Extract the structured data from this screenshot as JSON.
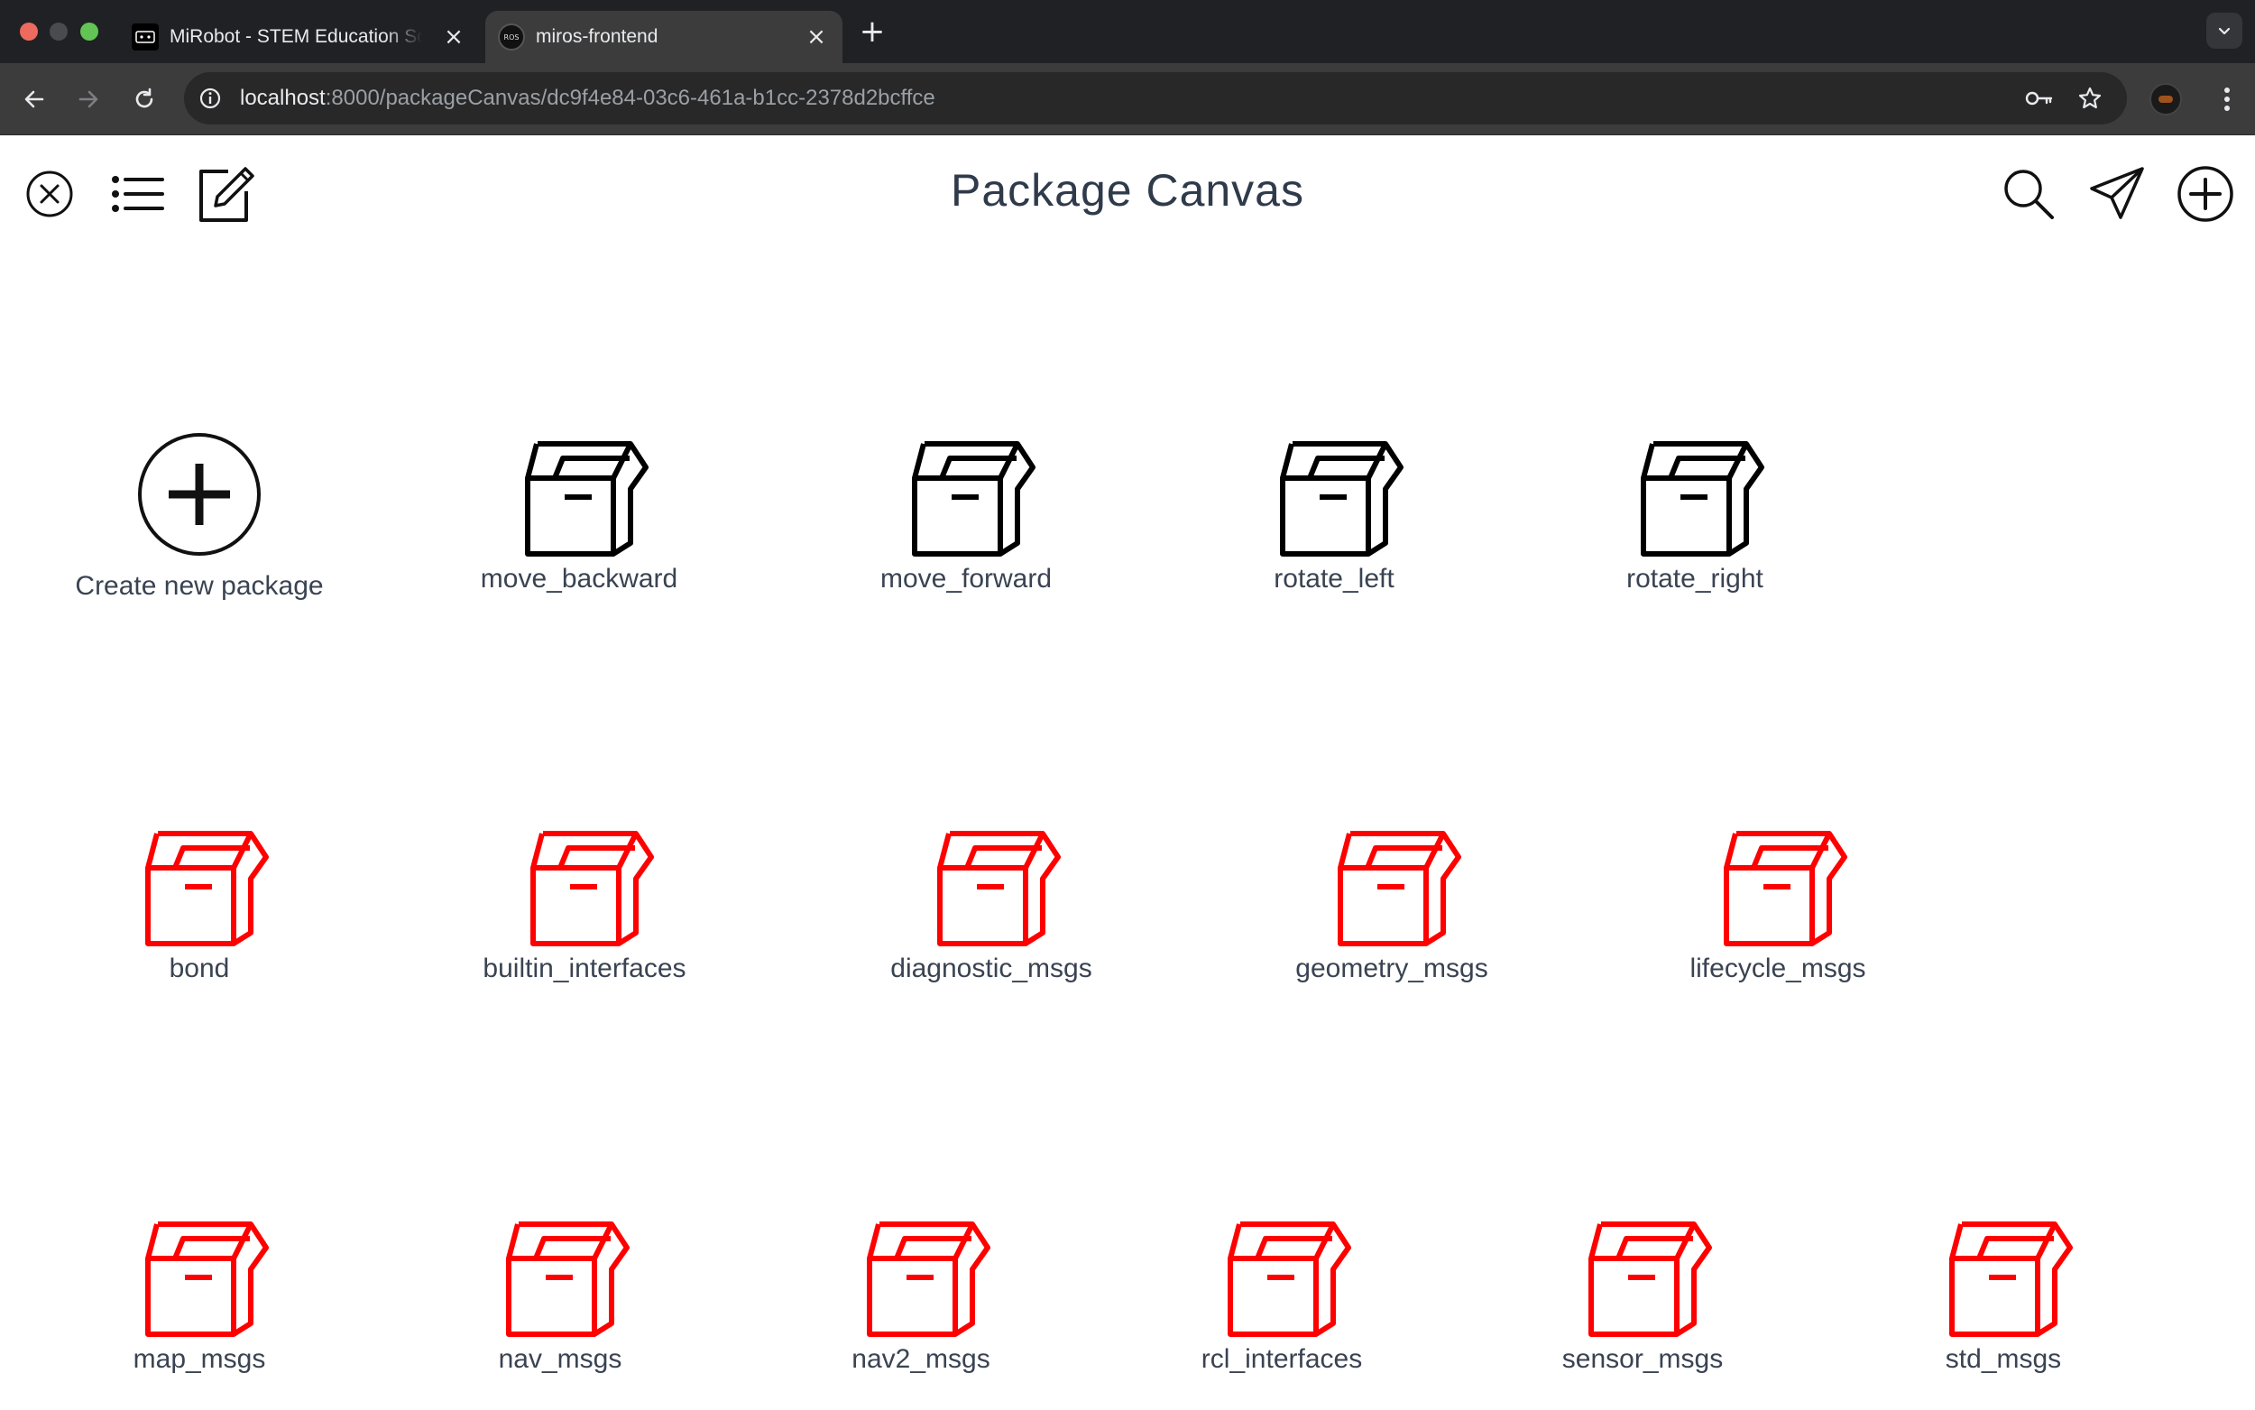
{
  "browser": {
    "tabs": [
      {
        "title": "MiRobot - STEM Education Solutions",
        "active": false
      },
      {
        "title": "miros-frontend",
        "active": true
      }
    ],
    "favicon_text_ros": "ROS",
    "new_tab_label": "+",
    "close_glyph": "×",
    "url_host": "localhost",
    "url_rest": ":8000/packageCanvas/dc9f4e84-03c6-461a-b1cc-2378d2bcffce"
  },
  "app": {
    "title": "Package Canvas",
    "create_label": "Create new package",
    "header_icons_left": [
      "close-circle-icon",
      "list-icon",
      "edit-icon"
    ],
    "header_icons_right": [
      "search-icon",
      "send-icon",
      "add-circle-icon"
    ]
  },
  "packages": {
    "custom": [
      "move_backward",
      "move_forward",
      "rotate_left",
      "rotate_right"
    ],
    "system_row1": [
      "bond",
      "builtin_interfaces",
      "diagnostic_msgs",
      "geometry_msgs",
      "lifecycle_msgs"
    ],
    "system_row2": [
      "map_msgs",
      "nav_msgs",
      "nav2_msgs",
      "rcl_interfaces",
      "sensor_msgs",
      "std_msgs"
    ]
  },
  "colors": {
    "custom_package": "#000000",
    "system_package": "#ff0000",
    "title_text": "#2f3a4a",
    "chrome_dark": "#202124",
    "chrome_toolbar": "#3c3c3c"
  }
}
